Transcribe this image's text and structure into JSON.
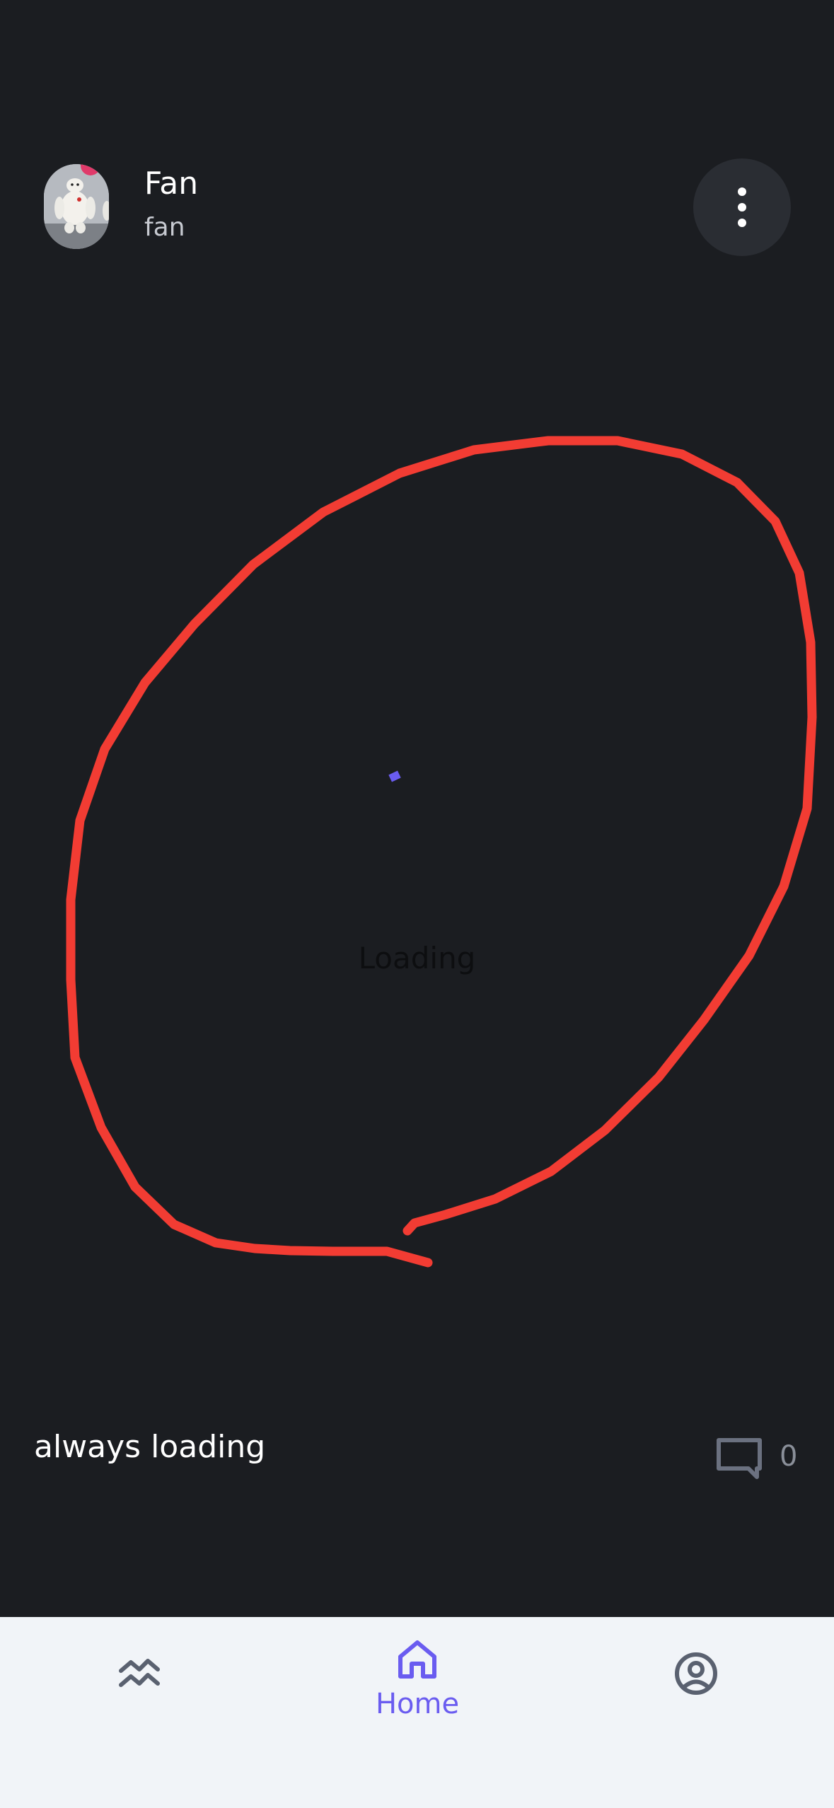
{
  "header": {
    "user_name": "Fan",
    "user_handle": "fan",
    "avatar_icon": "baymax-figure-avatar",
    "more_icon": "more-vertical-icon"
  },
  "post": {
    "loading_text": "Loading",
    "caption": "always loading",
    "comment_count": "0",
    "comment_icon": "comment-icon",
    "annotation_color": "#f23c33",
    "spinner_color": "#6a5cf0"
  },
  "nav": {
    "items": [
      {
        "id": "activity",
        "icon": "activity-icon",
        "label": ""
      },
      {
        "id": "home",
        "icon": "home-icon",
        "label": "Home"
      },
      {
        "id": "profile",
        "icon": "profile-icon",
        "label": ""
      }
    ],
    "active_color": "#6a5cf0",
    "inactive_color": "#5a6170"
  }
}
